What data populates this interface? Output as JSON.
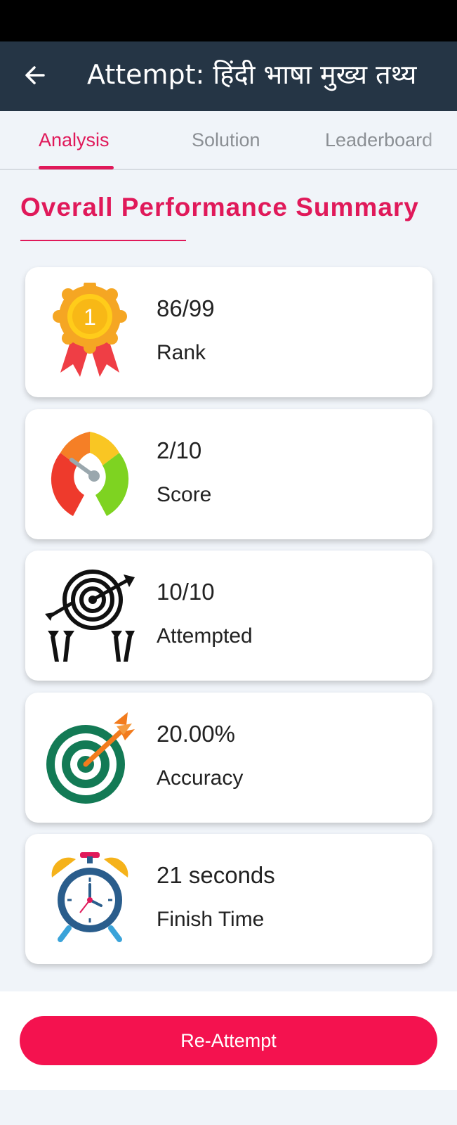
{
  "app_bar": {
    "title": "Attempt: हिंदी भाषा मुख्य तथ्य"
  },
  "tabs": [
    {
      "label": "Analysis",
      "active": true
    },
    {
      "label": "Solution",
      "active": false
    },
    {
      "label": "Leaderboard",
      "active": false
    }
  ],
  "summary": {
    "title": "Overall Performance Summary",
    "cards": [
      {
        "icon": "rank-ribbon-icon",
        "badge": "1",
        "value": "86/99",
        "label": "Rank"
      },
      {
        "icon": "score-gauge-icon",
        "value": "2/10",
        "label": "Score"
      },
      {
        "icon": "attempted-darts-icon",
        "value": "10/10",
        "label": "Attempted"
      },
      {
        "icon": "accuracy-target-icon",
        "value": "20.00%",
        "label": "Accuracy"
      },
      {
        "icon": "alarm-clock-icon",
        "value": "21 seconds",
        "label": "Finish Time"
      }
    ]
  },
  "actions": {
    "reattempt_label": "Re-Attempt"
  },
  "colors": {
    "accent": "#e0195a",
    "app_bar": "#253545",
    "button": "#f4124f"
  }
}
